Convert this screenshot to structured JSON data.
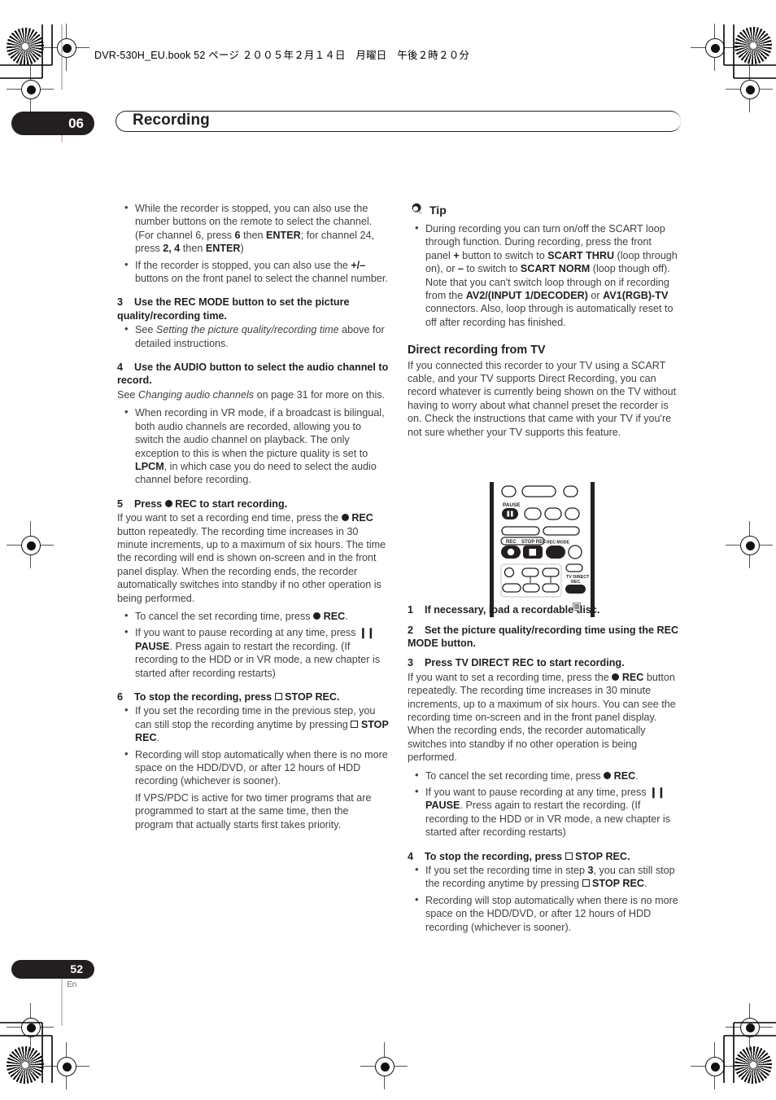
{
  "document": {
    "book_label": "DVR-530H_EU.book  52 ページ  ２００５年２月１４日　月曜日　午後２時２０分",
    "chapter_number": "06",
    "chapter_title": "Recording",
    "page_number": "52",
    "page_language": "En"
  },
  "left_column": {
    "intro_bullets": [
      "While the recorder is stopped, you can also use the number buttons on the remote to select the channel. (For channel 6, press 6 then ENTER; for channel 24, press 2, 4 then ENTER)",
      "If the recorder is stopped, you can also use the +/– buttons on the front panel to select the channel number."
    ],
    "step3": {
      "num": "3",
      "title": "Use the REC MODE button to set the picture quality/recording time.",
      "bullet": "See Setting the picture quality/recording time above for detailed instructions."
    },
    "step4": {
      "num": "4",
      "title": "Use the AUDIO button to select the audio channel to record.",
      "body": "See Changing audio channels on page 31 for more on this.",
      "bullet": "When recording in VR mode, if a broadcast is bilingual, both audio channels are recorded, allowing you to switch the audio channel on playback. The only exception to this is when the picture quality is set to LPCM, in which case you do need to select the audio channel before recording."
    },
    "step5": {
      "num": "5",
      "title": "Press ● REC to start recording.",
      "body": "If you want to set a recording end time, press the ● REC button repeatedly. The recording time increases in 30 minute increments, up to a maximum of six hours. The time the recording will end is shown on-screen and in the front panel display. When the recording ends, the recorder automatically switches into standby if no other operation is being performed.",
      "bullets": [
        "To cancel the set recording time, press ● REC.",
        "If you want to pause recording at any time, press ❙❙ PAUSE. Press again to restart the recording. (If recording to the HDD or in VR mode, a new chapter is started after recording restarts)"
      ]
    },
    "step6": {
      "num": "6",
      "title": "To stop the recording, press ☐ STOP REC.",
      "bullets": [
        "If you set the recording time in the previous step, you can still stop the recording anytime by pressing ☐ STOP REC.",
        "Recording will stop automatically when there is no more space on the HDD/DVD, or after 12 hours of HDD recording (whichever is sooner).",
        "If VPS/PDC is active for two timer programs that are programmed to start at the same time, then the program that actually starts first takes priority."
      ]
    }
  },
  "right_column": {
    "tip": {
      "icon": "gear-icon",
      "label": "Tip",
      "bullet": "During recording you can turn on/off the SCART loop through function. During recording, press the front panel + button to switch to SCART THRU (loop through on), or – to switch to SCART NORM (loop though off). Note that you can't switch loop through on if recording from the AV2/(INPUT 1/DECODER) or AV1(RGB)-TV connectors. Also, loop through is automatically reset to off after recording has finished."
    },
    "section": {
      "heading": "Direct recording from TV",
      "body": "If you connected this recorder to your TV using a SCART cable, and your TV supports Direct Recording, you can record whatever is currently being shown on the TV without having to worry about what channel preset the recorder is on. Check the instructions that came with your TV if you're not sure whether your TV supports this feature."
    },
    "remote": {
      "labels": {
        "pause": "PAUSE",
        "rec": "REC",
        "stop_rec": "STOP REC",
        "rec_mode": "REC MODE",
        "tv_direct_rec_line1": "TV DIRECT",
        "tv_direct_rec_line2": "REC"
      }
    },
    "step1": {
      "num": "1",
      "title": "If necessary, load a recordable disc."
    },
    "step2": {
      "num": "2",
      "title": "Set the picture quality/recording time using the REC MODE button."
    },
    "step3": {
      "num": "3",
      "title": "Press TV DIRECT REC to start recording.",
      "body": "If you want to set a recording time, press the ● REC button repeatedly. The recording time increases in 30 minute increments, up to a maximum of six hours. You can see the recording time on-screen and in the front panel display. When the recording ends, the recorder automatically switches into standby if no other operation is being performed.",
      "bullets": [
        "To cancel the set recording time, press ● REC.",
        "If you want to pause recording at any time, press ❙❙ PAUSE. Press again to restart the recording. (If recording to the HDD or in VR mode, a new chapter is started after recording restarts)"
      ]
    },
    "step4": {
      "num": "4",
      "title": "To stop the recording, press ☐ STOP REC.",
      "bullets": [
        "If you set the recording time in step 3, you can still stop the recording anytime by pressing ☐ STOP REC.",
        "Recording will stop automatically when there is no more space on the HDD/DVD, or after 12 hours of HDD recording (whichever is sooner)."
      ]
    }
  },
  "colors": {
    "ink_dark": "#231f20",
    "body_gray": "#414141",
    "badge_bg": "#231f20"
  }
}
